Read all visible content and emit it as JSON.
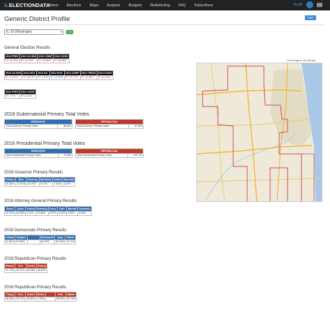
{
  "nav": {
    "brand_il": "IL",
    "brand_rest": "ELECTIONDATA",
    "items": [
      "About",
      "Elections",
      "Maps",
      "Analysis",
      "Budgets",
      "Redistricting",
      "FAQ",
      "Subscribers"
    ],
    "user": "Scott"
  },
  "page": {
    "title": "Generic District Profile",
    "pdf": "PDF",
    "district_select": "IL-16 (Kinzinger)",
    "go": "Go!"
  },
  "general": {
    "heading": "General Election Results",
    "row1_headers": [
      "2016 PRES",
      "2016 US SEN",
      "2016 COMP",
      "2016 CONG"
    ],
    "row1_values": [
      "R+ 16.79%",
      "R+ 14.43%",
      "R+ 21.68%",
      "R+ 99.89%"
    ],
    "row2_headers": [
      "2014 US SEN",
      "2014 GOV",
      "2014 AG",
      "2014 SOS",
      "2014 COMP",
      "2014 TREAS",
      "2014 CONG"
    ],
    "row2_values": [
      "R+ 15.21%",
      "R+ 28.11%",
      "D+ 1.41%",
      "D+ 15.84%",
      "R+ 27.77%",
      "R+ 23.86%",
      "R+ 41.24%"
    ],
    "row3_headers": [
      "2012 PRES",
      "2012 CONG"
    ],
    "row3_values": [
      "R+ 7.7%",
      "R+ 22.8%"
    ],
    "map_note": "Click image to see full size"
  },
  "gov_total": {
    "heading": "2018 Gubernatorial Primary Total Votes",
    "dem_label": "DEMOCRAT",
    "rep_label": "REPUBLICAN",
    "dem_row": [
      "Total Governor Primary Votes",
      "48,091"
    ],
    "rep_row": [
      "Total Governor Primary Votes",
      "67,839"
    ]
  },
  "pres_total": {
    "heading": "2016 Presidential Primary Total Votes",
    "dem_label": "DEMOCRAT",
    "rep_label": "REPUBLICAN",
    "dem_row": [
      "Total Presidential Primary Votes",
      "72,462"
    ],
    "rep_row": [
      "Total Presidential Primary Votes",
      "119,729"
    ]
  },
  "gov_primary": {
    "heading": "2018 Governor Primary Results",
    "headers": [
      "Pritzker",
      "Biss",
      "Kennedy",
      "Hardiman",
      "Daiber",
      "Marshall"
    ],
    "values": [
      "40.35%",
      "27.91%",
      "18.79%",
      "9.71%",
      "1.15%",
      "1.20%"
    ]
  },
  "ag_primary": {
    "heading": "2018 Attorney General Primary Results",
    "headers": [
      "Raoul",
      "Quinn",
      "Fairley",
      "Rotering",
      "Drury",
      "Ruiz",
      "Mariotti",
      "Goldstein"
    ],
    "values": [
      "16.79%",
      "42.38%",
      "9.14%",
      "12.26%",
      "8.97%",
      "4.29%",
      "5.39%",
      "3.48%"
    ]
  },
  "dem16": {
    "heading": "2016 Democratic Primary Results",
    "headers": [
      "Clinton",
      "Sanders",
      "Duckworth",
      "Zopp",
      "Harris"
    ],
    "values": [
      "41.30%",
      "57.85%",
      "",
      "69.79%",
      "20.10%",
      "10.11%"
    ]
  },
  "rep18": {
    "heading": "2018 Republican Primary Results",
    "headers": [
      "Rauner",
      "Ives",
      "Harold",
      "Grasso"
    ],
    "values": [
      "51.73%",
      "48.22%",
      "54.38%",
      "45.62%"
    ]
  },
  "rep16": {
    "heading": "2016 Republican Primary Results",
    "headers": [
      "Trump",
      "Cruz",
      "Kasich",
      "Rubio",
      "Kirk",
      "Marter"
    ],
    "values": [
      "38.98%",
      "34.70%",
      "15.60%",
      "7.29%",
      "69.25%",
      "30.75%"
    ]
  }
}
